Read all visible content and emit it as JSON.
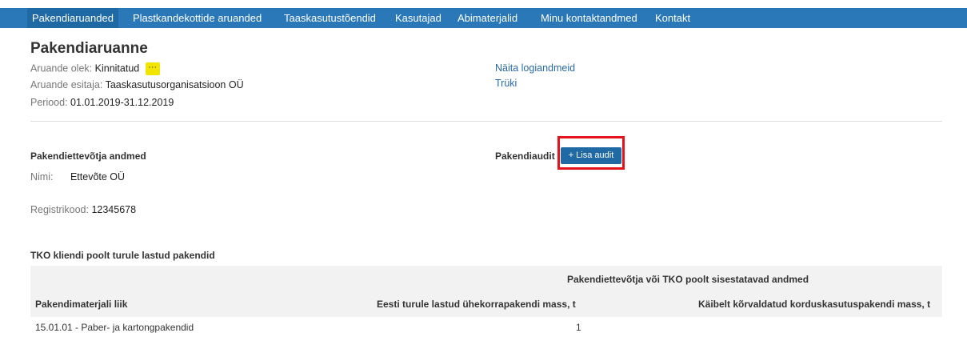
{
  "nav": {
    "items": [
      {
        "label": "Pakendiaruanded",
        "active": true
      },
      {
        "label": "Plastkandekottide aruanded",
        "active": false
      },
      {
        "label": "Taaskasutustõendid",
        "active": false
      },
      {
        "label": "Kasutajad",
        "active": false
      },
      {
        "label": "Abimaterjalid",
        "active": false
      },
      {
        "label": "Minu kontaktandmed",
        "active": false
      },
      {
        "label": "Kontakt",
        "active": false
      }
    ]
  },
  "report": {
    "title": "Pakendiaruanne",
    "status_label": "Aruande olek:",
    "status_value": "Kinnitatud",
    "status_menu": "···",
    "submitter_label": "Aruande esitaja:",
    "submitter_value": "Taaskasutusorganisatsioon OÜ",
    "period_label": "Periood:",
    "period_value": "01.01.2019-31.12.2019"
  },
  "links": {
    "log": "Näita logiandmeid",
    "print": "Trüki"
  },
  "company": {
    "section_title": "Pakendiettevõtja andmed",
    "name_label": "Nimi:",
    "name_value": "Ettevõte OÜ",
    "reg_label": "Registrikood:",
    "reg_value": "12345678"
  },
  "audit": {
    "section_title": "Pakendiaudit",
    "add_button": "+ Lisa audit"
  },
  "table": {
    "caption": "TKO kliendi poolt turule lastud pakendid",
    "group_header": "Pakendiettevõtja või TKO poolt sisestatavad andmed",
    "columns": [
      "Pakendimaterjali liik",
      "Eesti turule lastud ühekorrapakendi mass, t",
      "Käibelt kõrvaldatud korduskasutuspakendi mass, t"
    ],
    "rows": [
      {
        "material": "15.01.01 - Paber- ja kartongpakendid",
        "single_use_mass": "1",
        "reuse_mass": ""
      }
    ]
  },
  "colors": {
    "nav_bg": "#2a78b8",
    "button_bg": "#1f6aa5",
    "highlight": "#e3141b",
    "menu_button": "#f2e500"
  }
}
